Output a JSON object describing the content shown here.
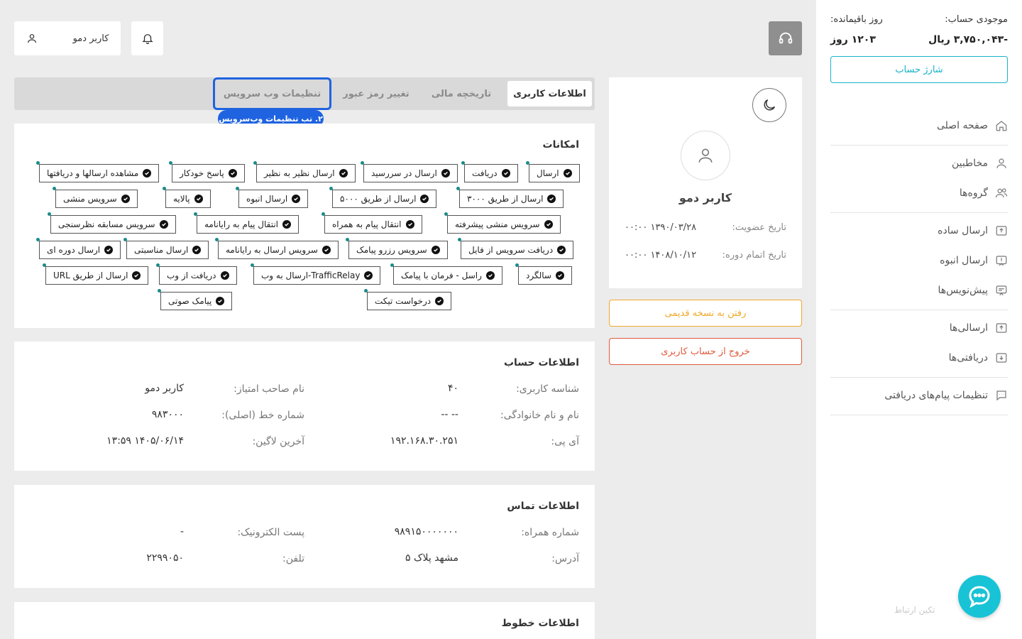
{
  "sidebar": {
    "balance_label": "موجودی حساب:",
    "balance_value": "-۳,۷۵۰,۰۴۳ ریال",
    "days_label": "روز باقیمانده:",
    "days_value": "۱۲۰۳ روز",
    "charge_button": "شارژ حساب",
    "items": [
      {
        "label": "صفحه اصلی",
        "icon": "home-icon"
      },
      {
        "label": "مخاطبین",
        "icon": "user-icon"
      },
      {
        "label": "گروه‌ها",
        "icon": "users-icon"
      },
      {
        "label": "ارسال ساده",
        "icon": "send-box-icon"
      },
      {
        "label": "ارسال انبوه",
        "icon": "bulk-send-icon"
      },
      {
        "label": "پیش‌نویس‌ها",
        "icon": "draft-icon"
      },
      {
        "label": "ارسالی‌ها",
        "icon": "outbox-icon"
      },
      {
        "label": "دریافتی‌ها",
        "icon": "inbox-icon"
      },
      {
        "label": "تنظیمات پیام‌های دریافتی",
        "icon": "message-settings-icon"
      }
    ],
    "brand": "تکین ارتباط"
  },
  "header": {
    "user_name": "کاربر دمو"
  },
  "profile": {
    "name": "کاربر دمو",
    "member_since_label": "تاریخ عضویت:",
    "member_since_value": "۱۳۹۰/۰۳/۲۸ ۰۰:۰۰",
    "expiry_label": "تاریخ اتمام دوره:",
    "expiry_value": "۱۴۰۸/۱۰/۱۲ ۰۰:۰۰",
    "old_version_button": "رفتن به نسخه قدیمی",
    "logout_button": "خروج از حساب کاربری"
  },
  "tabs": [
    {
      "label": "اطلاعات کاربری",
      "active": true
    },
    {
      "label": "تاریخچه مالی",
      "active": false
    },
    {
      "label": "تغییر رمز عبور",
      "active": false
    },
    {
      "label": "تنظیمات وب سرویس",
      "active": false
    }
  ],
  "callout": "۲. تب تنظیمات وب‌سرویس",
  "features": {
    "title": "امکانات",
    "chips": [
      "ارسال",
      "دریافت",
      "ارسال در سررسید",
      "ارسال نظیر به نظیر",
      "پاسخ خودکار",
      "مشاهده ارسالها و دریافتها",
      "ارسال از طریق ۳۰۰۰",
      "ارسال از طریق ۵۰۰۰",
      "ارسال انبوه",
      "پالایه",
      "سرویس منشی",
      "سرویس منشی پیشرفته",
      "انتقال پیام به همراه",
      "انتقال پیام به رایانامه",
      "سرویس مسابقه نظرسنجی",
      "دریافت سرویس از فایل",
      "سرویس رزرو پیامک",
      "سرویس ارسال به رایانامه",
      "ارسال مناسبتی",
      "ارسال دوره ای",
      "سالگرد",
      "راسل - فرمان با پیامک",
      "TrafficRelay-ارسال به وب",
      "دریافت از وب",
      "ارسال از طریق URL",
      "درخواست تیکت",
      "پیامک صوتی"
    ]
  },
  "account": {
    "title": "اطلاعات حساب",
    "user_id_label": "شناسه کاربری:",
    "user_id_value": "۴۰",
    "owner_label": "نام صاحب امتیاز:",
    "owner_value": "کاربر دمو",
    "fullname_label": "نام و نام خانوادگی:",
    "fullname_value": "-- --",
    "line_label": "شماره خط (اصلی):",
    "line_value": "۹۸۳۰۰۰",
    "ip_label": "آی پی:",
    "ip_value": "۱۹۲.۱۶۸.۳۰.۲۵۱",
    "last_login_label": "آخرین لاگین:",
    "last_login_value": "۱۴۰۵/۰۶/۱۴ ۱۳:۵۹"
  },
  "contact": {
    "title": "اطلاعات تماس",
    "mobile_label": "شماره همراه:",
    "mobile_value": "۹۸۹۱۵۰۰۰۰۰۰۰",
    "email_label": "پست الکترونیک:",
    "email_value": "-",
    "address_label": "آدرس:",
    "address_value": "مشهد پلاک ۵",
    "phone_label": "تلفن:",
    "phone_value": "۲۲۹۹۰۵۰"
  },
  "lines": {
    "title": "اطلاعات خطوط"
  }
}
